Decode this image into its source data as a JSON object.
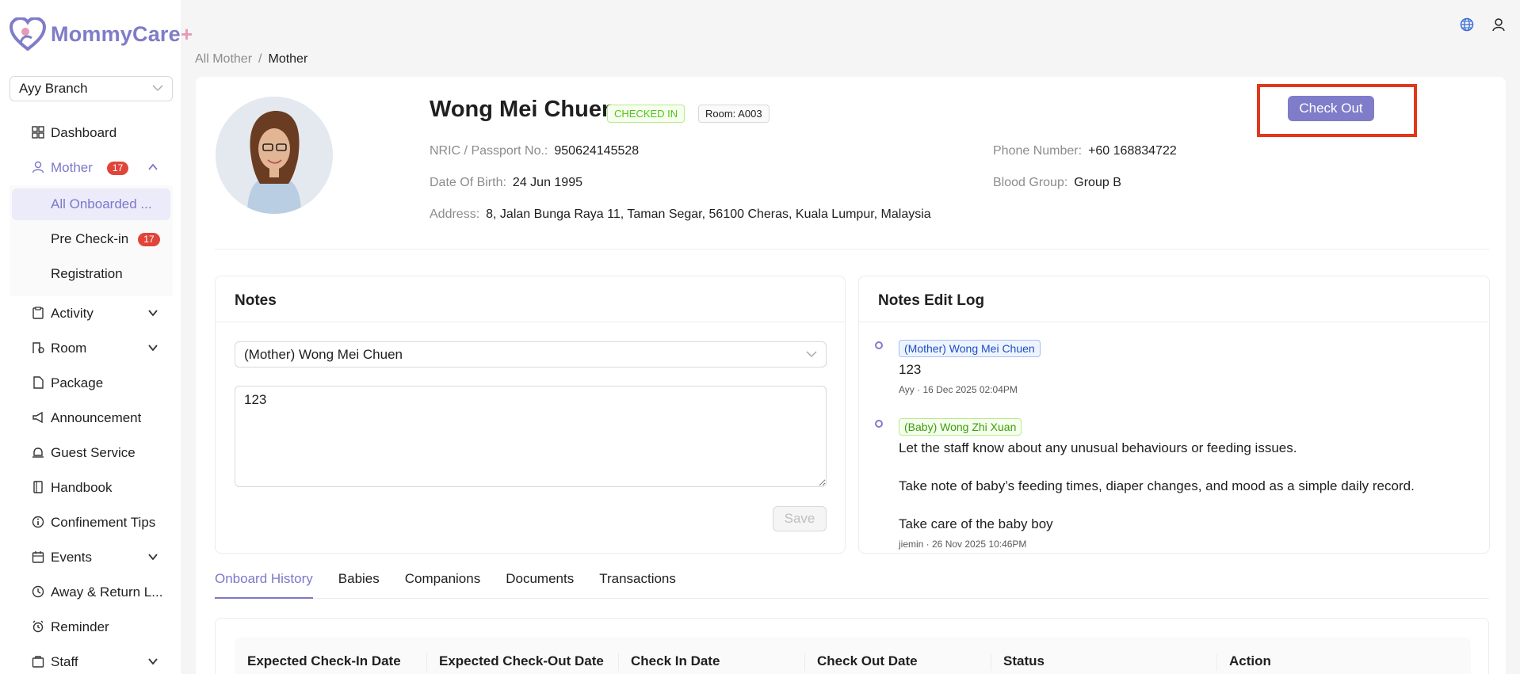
{
  "app": {
    "logo_text": "MommyCare",
    "logo_plus": "+"
  },
  "branch_select": {
    "value": "Ayy Branch"
  },
  "sidebar": {
    "items": [
      {
        "label": "Dashboard"
      },
      {
        "label": "Mother",
        "badge": "17"
      },
      {
        "label": "Activity"
      },
      {
        "label": "Room"
      },
      {
        "label": "Package"
      },
      {
        "label": "Announcement"
      },
      {
        "label": "Guest Service"
      },
      {
        "label": "Handbook"
      },
      {
        "label": "Confinement Tips"
      },
      {
        "label": "Events"
      },
      {
        "label": "Away & Return L..."
      },
      {
        "label": "Reminder"
      },
      {
        "label": "Staff"
      }
    ],
    "mother_sub": [
      {
        "label": "All Onboarded ..."
      },
      {
        "label": "Pre Check-in",
        "badge": "17"
      },
      {
        "label": "Registration"
      }
    ]
  },
  "breadcrumb": {
    "parent": "All Mother",
    "separator": "/",
    "current": "Mother"
  },
  "profile": {
    "name": "Wong Mei Chuen",
    "status": "CHECKED IN",
    "room": "Room: A003",
    "nric_label": "NRIC / Passport No.:",
    "nric": "950624145528",
    "dob_label": "Date Of Birth:",
    "dob": "24 Jun 1995",
    "address_label": "Address:",
    "address": "8, Jalan Bunga Raya 11, Taman Segar, 56100 Cheras, Kuala Lumpur, Malaysia",
    "phone_label": "Phone Number:",
    "phone": "+60 168834722",
    "blood_label": "Blood Group:",
    "blood": "Group B"
  },
  "checkout_button": "Check Out",
  "notes": {
    "title": "Notes",
    "select_value": "(Mother) Wong Mei Chuen",
    "text": "123",
    "save_label": "Save"
  },
  "notes_log": {
    "title": "Notes Edit Log",
    "entries": [
      {
        "tag": "(Mother) Wong Mei Chuen",
        "text": "123",
        "meta": "Ayy · 16 Dec 2025 02:04PM"
      },
      {
        "tag": "(Baby) Wong Zhi Xuan",
        "line1": "Let the staff know about any unusual behaviours or feeding issues.",
        "line2": "Take note of baby’s feeding times, diaper changes, and mood as a simple daily record.",
        "line3": "Take care of the baby boy",
        "meta": "jiemin · 26 Nov 2025 10:46PM"
      }
    ]
  },
  "tabs": [
    "Onboard History",
    "Babies",
    "Companions",
    "Documents",
    "Transactions"
  ],
  "table": {
    "columns": [
      "Expected Check-In Date",
      "Expected Check-Out Date",
      "Check In Date",
      "Check Out Date",
      "Status",
      "Action"
    ]
  },
  "colors": {
    "brand": "#7f7cc9",
    "highlight_box": "#e0381b",
    "badge": "#e0453a"
  }
}
